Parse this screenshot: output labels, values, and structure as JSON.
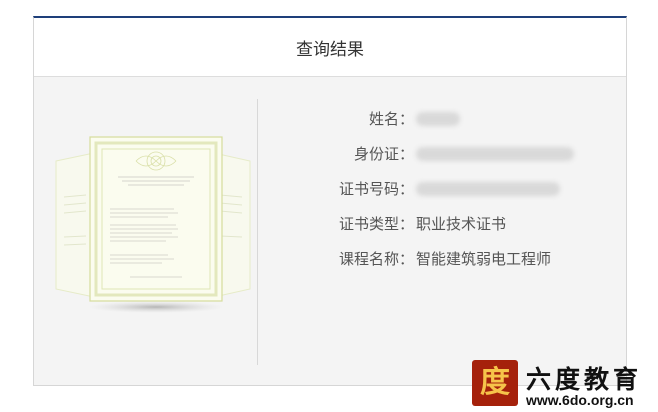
{
  "header": {
    "title": "查询结果"
  },
  "result": {
    "rows": [
      {
        "label": "姓名：",
        "value": ""
      },
      {
        "label": "身份证：",
        "value": ""
      },
      {
        "label": "证书号码：",
        "value": ""
      },
      {
        "label": "证书类型：",
        "value": "职业技术证书"
      },
      {
        "label": "课程名称：",
        "value": "智能建筑弱电工程师"
      }
    ]
  },
  "watermark": {
    "logo_char": "度",
    "name": "六度教育",
    "url": "www.6do.org.cn"
  },
  "colors": {
    "header_accent": "#1e3f7a",
    "panel_bg": "#f4f4f4",
    "logo_bg": "#a5210b",
    "logo_fg": "#f6c34a",
    "cert_frame": "#dfe8b0"
  }
}
